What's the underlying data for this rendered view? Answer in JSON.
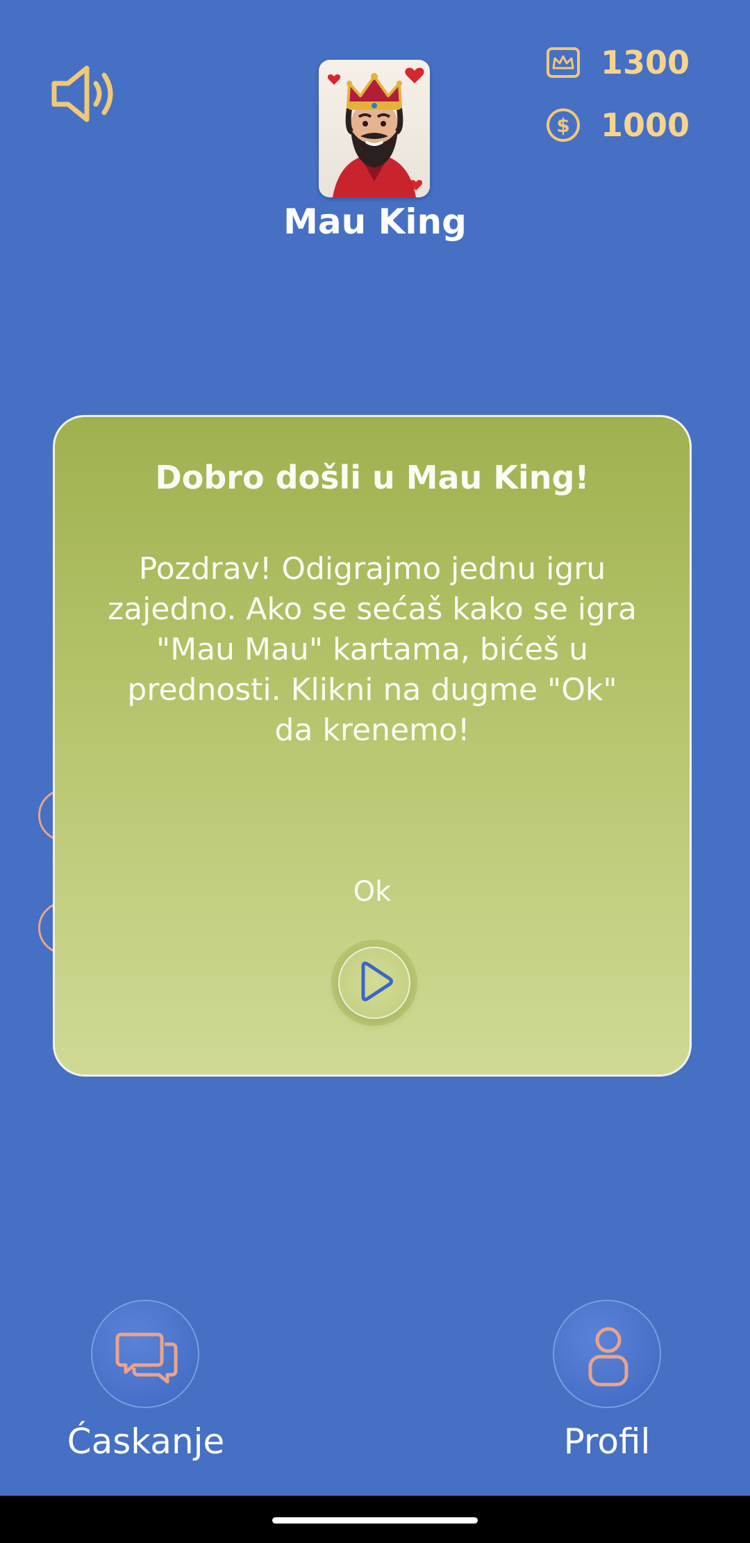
{
  "header": {
    "sound_icon": "speaker-icon",
    "title": "Mau King",
    "avatar_icon": "king-card-icon"
  },
  "stats": {
    "crown_icon": "crown-icon",
    "crown_value": "1300",
    "coin_icon": "dollar-coin-icon",
    "coin_value": "1000"
  },
  "dialog": {
    "title": "Dobro došli u Mau King!",
    "body": "Pozdrav! Odigrajmo jednu igru zajedno. Ako se sećaš kako se igra \"Mau Mau\" kartama, bićeš u prednosti. Klikni na dugme \"Ok\" da krenemo!",
    "ok_label": "Ok",
    "play_icon": "play-icon"
  },
  "bottom": {
    "chat_label": "Ćaskanje",
    "chat_icon": "chat-bubbles-icon",
    "profile_label": "Profil",
    "profile_icon": "person-icon"
  },
  "colors": {
    "background": "#4570c4",
    "accent_gold": "#f6d48d",
    "dialog_top": "#9fb14f",
    "dialog_bottom": "#cfd994",
    "icon_pink": "#e9a48c"
  }
}
